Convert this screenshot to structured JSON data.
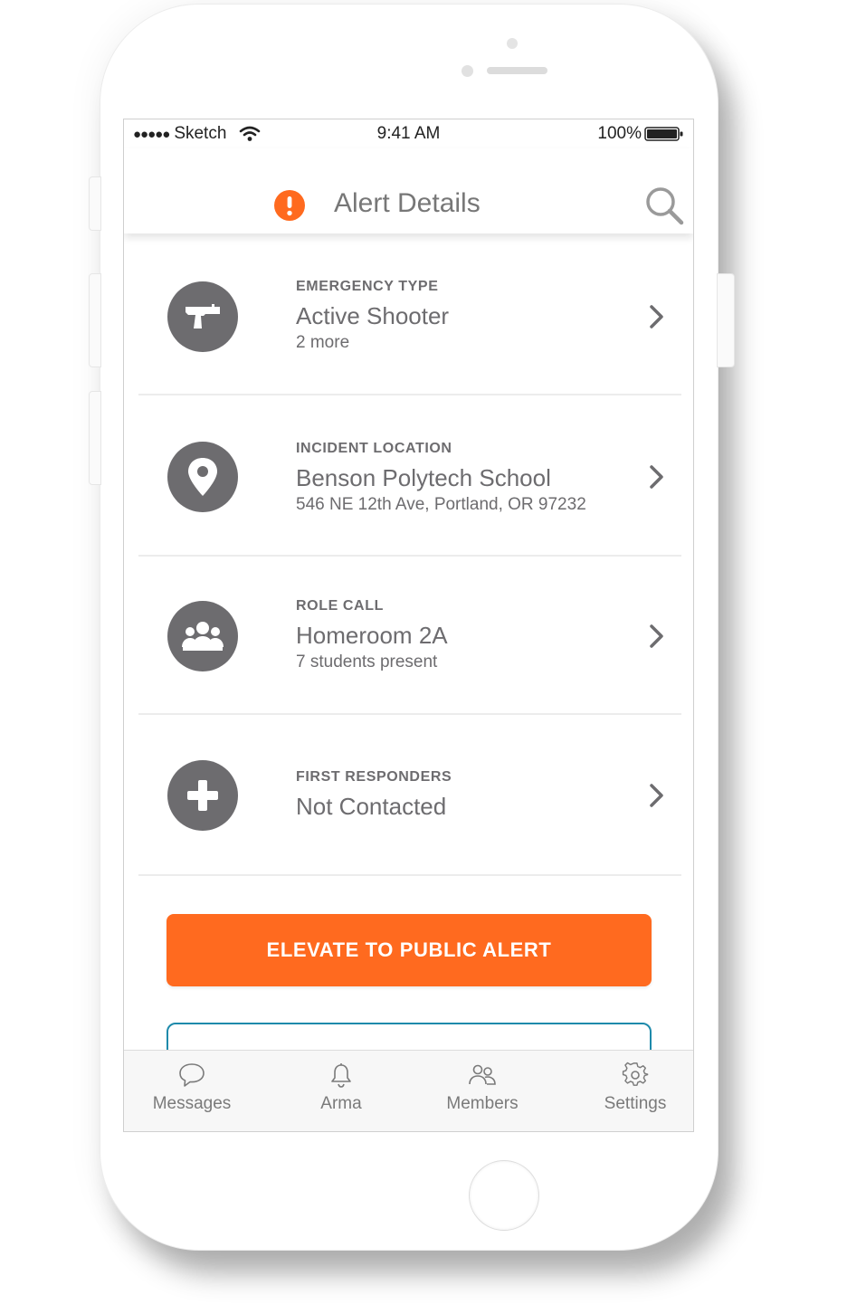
{
  "status_bar": {
    "carrier": "Sketch",
    "time": "9:41 AM",
    "battery": "100%"
  },
  "header": {
    "title": "Alert Details",
    "alert_color": "#ff6a1f"
  },
  "rows": [
    {
      "label": "EMERGENCY TYPE",
      "value": "Active Shooter",
      "sub": "2 more",
      "icon": "gun-icon"
    },
    {
      "label": "INCIDENT LOCATION",
      "value": "Benson Polytech School",
      "sub": "546 NE 12th Ave, Portland, OR 97232",
      "icon": "location-pin-icon"
    },
    {
      "label": "ROLE CALL",
      "value": "Homeroom 2A",
      "sub": "7 students present",
      "icon": "group-icon"
    },
    {
      "label": "FIRST RESPONDERS",
      "value": "Not Contacted",
      "sub": "",
      "icon": "plus-icon"
    }
  ],
  "actions": {
    "elevate_label": "ELEVATE TO PUBLIC ALERT",
    "elevate_color": "#ff6a1f",
    "secondary_border_color": "#1e8aab"
  },
  "tabs": [
    {
      "label": "Messages",
      "icon": "speech-bubble-icon"
    },
    {
      "label": "Arma",
      "icon": "bell-icon"
    },
    {
      "label": "Members",
      "icon": "people-icon"
    },
    {
      "label": "Settings",
      "icon": "gear-icon"
    }
  ]
}
